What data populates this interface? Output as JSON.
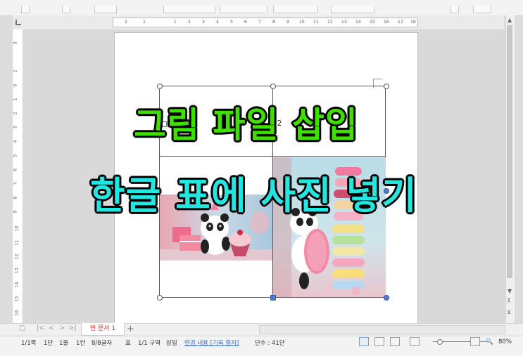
{
  "document": {
    "cells": [
      "",
      "2",
      "",
      ""
    ],
    "cell_label_prefix": "그"
  },
  "overlay": {
    "headline_1": "그림 파일 삽입",
    "headline_2": "한글 표에 사진 넣기",
    "headline_1_color": "#3ee000",
    "headline_2_color": "#22e6e0"
  },
  "tabs": {
    "items": [
      {
        "label": "빈 문서 1"
      }
    ],
    "add_label": "+",
    "nav": [
      "▢",
      "|<",
      "<",
      ">",
      ">|"
    ]
  },
  "statusbar": {
    "page": "1/1쪽",
    "column": "1단",
    "line": "1줄",
    "col": "1칸",
    "chars": "8/8글자",
    "mode": "표",
    "zone": "1/1 구역",
    "insert": "삽입",
    "track_changes": "변경 내용 [기록 중지]",
    "word_count": "단수 : 41단",
    "zoom": "80%"
  },
  "icons": {
    "corner": "tab-stop-icon",
    "scroll_up": "chevron-up-icon",
    "scroll_down": "chevron-down-icon"
  }
}
